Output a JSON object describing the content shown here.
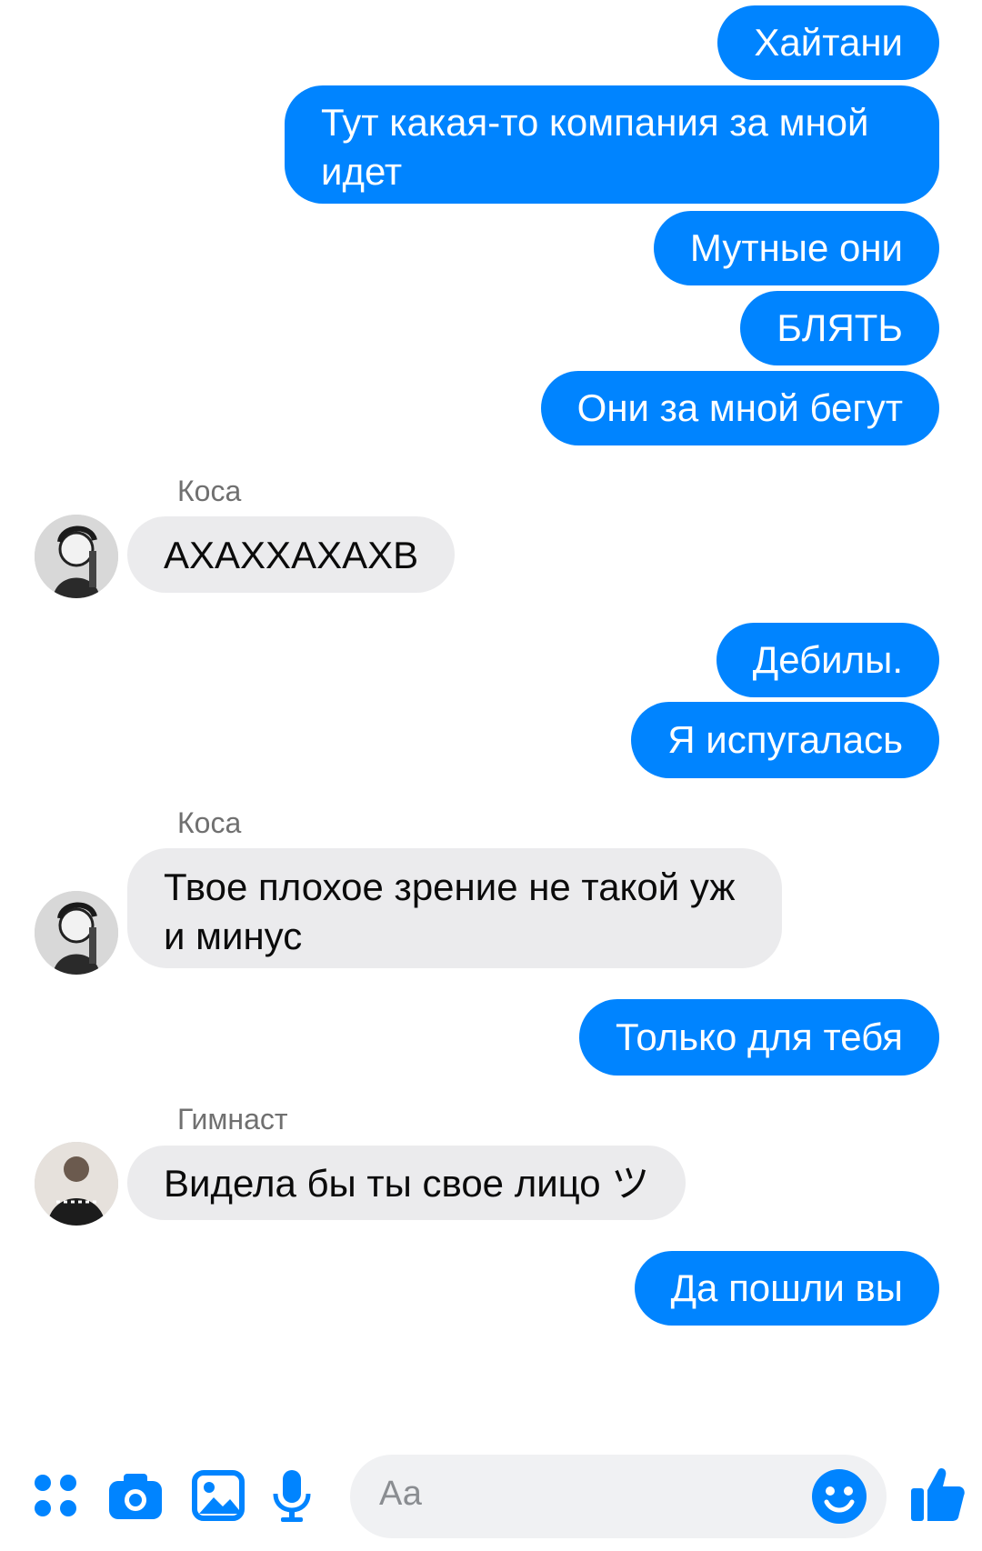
{
  "messages": [
    {
      "side": "me",
      "text": "Хайтани"
    },
    {
      "side": "me",
      "text": "Тут какая-то компания за мной идет"
    },
    {
      "side": "me",
      "text": "Мутные они"
    },
    {
      "side": "me",
      "text": "БЛЯТЬ"
    },
    {
      "side": "me",
      "text": "Они за мной бегут"
    },
    {
      "side": "them",
      "sender": "Коса",
      "text": "АХАХХАХАХВ"
    },
    {
      "side": "me",
      "text": "Дебилы."
    },
    {
      "side": "me",
      "text": "Я испугалась"
    },
    {
      "side": "them",
      "sender": "Коса",
      "text": "Твое плохое зрение не такой уж и минус"
    },
    {
      "side": "me",
      "text": "Только для тебя"
    },
    {
      "side": "them",
      "sender": "Гимнаст",
      "text": "Видела бы ты свое лицо ツ"
    },
    {
      "side": "me",
      "text": "Да пошли вы"
    }
  ],
  "composer": {
    "placeholder": "Аа",
    "icons": [
      "apps-icon",
      "camera-icon",
      "gallery-icon",
      "microphone-icon",
      "emoji-icon",
      "like-icon"
    ]
  },
  "colors": {
    "outgoing_bubble": "#0084ff",
    "incoming_bubble": "#ebebed",
    "accent": "#0084ff"
  }
}
